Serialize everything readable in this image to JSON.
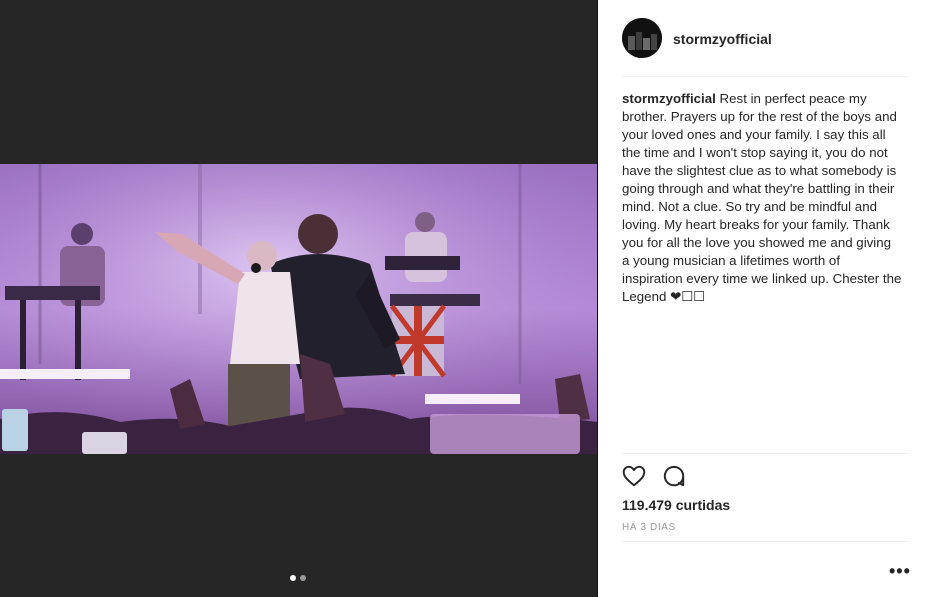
{
  "post": {
    "username": "stormzyofficial",
    "caption_username": "stormzyofficial",
    "caption_text": "Rest in perfect peace my brother. Prayers up for the rest of the boys and your loved ones and your family. I say this all the time and I won't stop saying it, you do not have the slightest clue as to what somebody is going through and what they're battling in their mind. Not a clue. So try and be mindful and loving. My heart breaks for your family. Thank you for all the love you showed me and giving a young musician a lifetimes worth of inspiration every time we linked up. Chester the Legend ❤︎☐☐",
    "likes": "119.479 curtidas",
    "timestamp": "HÁ 3 DIAS"
  },
  "carousel": {
    "count": 2,
    "active_index": 0
  },
  "icons": {
    "like": "heart-outline-icon",
    "comment": "speech-bubble-icon",
    "more": "more-options-icon"
  },
  "colors": {
    "media_background": "#262626",
    "stage_light": "#b48ad6",
    "text": "#262626",
    "muted": "#999999"
  }
}
